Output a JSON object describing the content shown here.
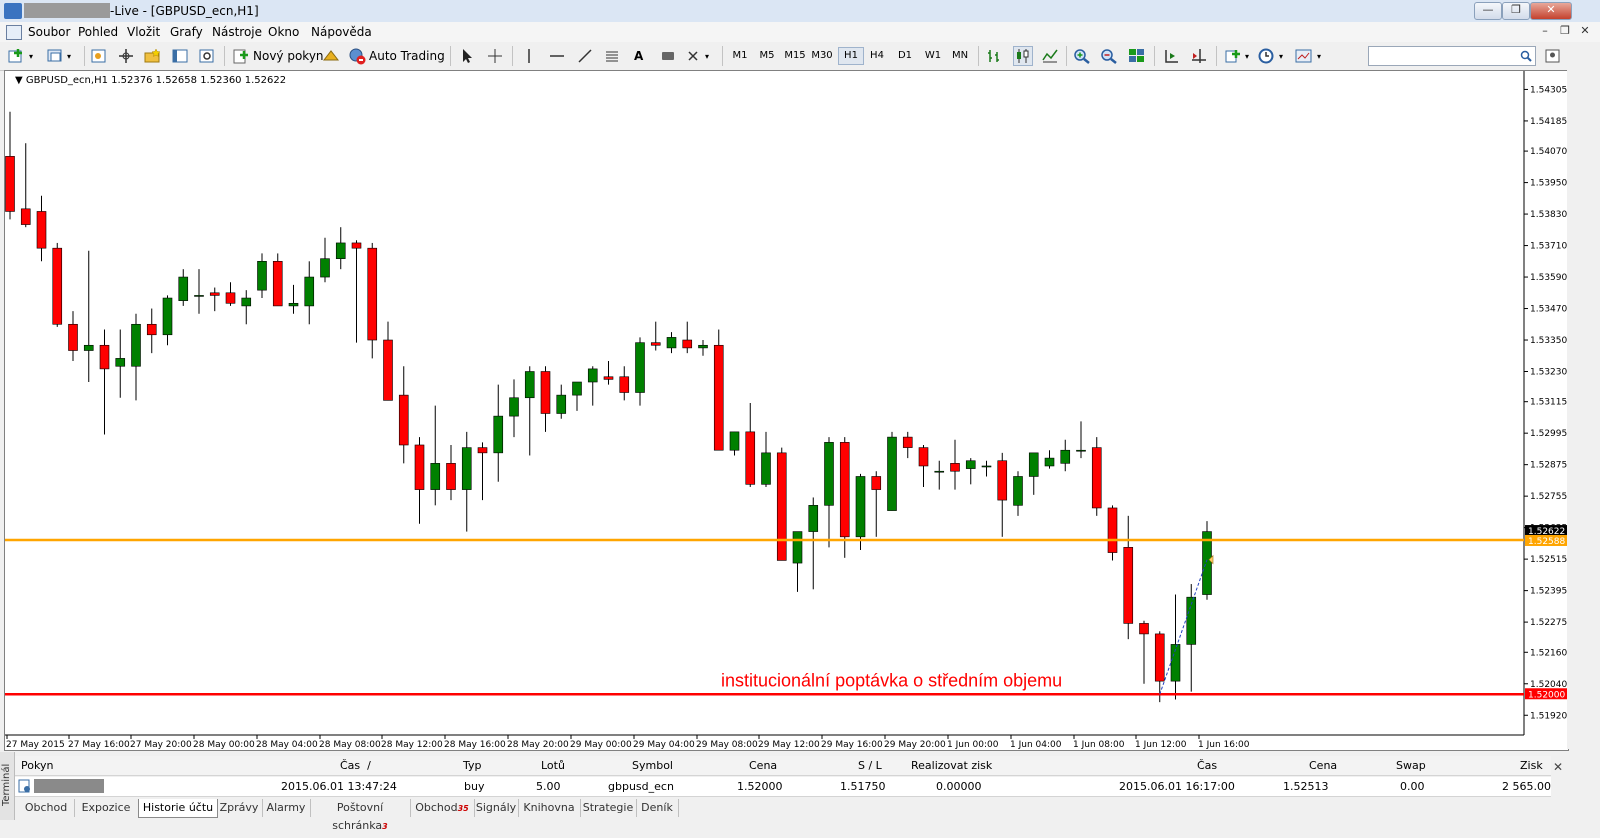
{
  "window": {
    "title": "-Live - [GBPUSD_ecn,H1]",
    "controls": [
      "—",
      "❐",
      "✕"
    ]
  },
  "menu": {
    "items": [
      "Soubor",
      "Pohled",
      "Vložit",
      "Grafy",
      "Nástroje",
      "Okno",
      "Nápověda"
    ]
  },
  "toolbar": {
    "new_order_label": "Nový pokyn",
    "auto_trading_label": "Auto Trading",
    "text_tool_label": "A",
    "timeframes": [
      "M1",
      "M5",
      "M15",
      "M30",
      "H1",
      "H4",
      "D1",
      "W1",
      "MN"
    ],
    "active_timeframe": "H1"
  },
  "chart": {
    "header": "GBPUSD_ecn,H1  1.52376 1.52658 1.52360 1.52622",
    "annotation": "institucionální poptávka o středním objemu",
    "price_labels": [
      "1.54305",
      "1.54185",
      "1.54070",
      "1.53950",
      "1.53830",
      "1.53710",
      "1.53590",
      "1.53470",
      "1.53350",
      "1.53230",
      "1.53115",
      "1.52995",
      "1.52875",
      "1.52755",
      "1.52635",
      "1.52515",
      "1.52395",
      "1.52275",
      "1.52160",
      "1.52040",
      "1.51920"
    ],
    "current_price": "1.52622",
    "orange_level": "1.52588",
    "red_level": "1.52000",
    "time_labels": [
      "27 May 2015",
      "27 May 16:00",
      "27 May 20:00",
      "28 May 00:00",
      "28 May 04:00",
      "28 May 08:00",
      "28 May 12:00",
      "28 May 16:00",
      "28 May 20:00",
      "29 May 00:00",
      "29 May 04:00",
      "29 May 08:00",
      "29 May 12:00",
      "29 May 16:00",
      "29 May 20:00",
      "1 Jun 00:00",
      "1 Jun 04:00",
      "1 Jun 08:00",
      "1 Jun 12:00",
      "1 Jun 16:00"
    ],
    "colors": {
      "bull": "#008000",
      "bear": "#ff0000",
      "orange_line": "#ffa500",
      "red_line": "#ff0000",
      "annotation": "#ff0000"
    }
  },
  "chart_data": {
    "type": "candlestick",
    "title": "GBPUSD_ecn,H1",
    "ylim": [
      1.5186,
      1.5436
    ],
    "candles": [
      {
        "o": 1.5405,
        "h": 1.5422,
        "l": 1.5381,
        "c": 1.5384
      },
      {
        "o": 1.5385,
        "h": 1.541,
        "l": 1.5378,
        "c": 1.5379
      },
      {
        "o": 1.5384,
        "h": 1.539,
        "l": 1.5365,
        "c": 1.537
      },
      {
        "o": 1.537,
        "h": 1.5372,
        "l": 1.534,
        "c": 1.5341
      },
      {
        "o": 1.5341,
        "h": 1.5346,
        "l": 1.5327,
        "c": 1.5331
      },
      {
        "o": 1.5331,
        "h": 1.5369,
        "l": 1.5319,
        "c": 1.5333
      },
      {
        "o": 1.5333,
        "h": 1.5339,
        "l": 1.5299,
        "c": 1.5324
      },
      {
        "o": 1.5325,
        "h": 1.5339,
        "l": 1.5313,
        "c": 1.5328
      },
      {
        "o": 1.5325,
        "h": 1.5345,
        "l": 1.5312,
        "c": 1.5341
      },
      {
        "o": 1.5341,
        "h": 1.5347,
        "l": 1.533,
        "c": 1.5337
      },
      {
        "o": 1.5337,
        "h": 1.5352,
        "l": 1.5333,
        "c": 1.5351
      },
      {
        "o": 1.535,
        "h": 1.5362,
        "l": 1.5348,
        "c": 1.5359
      },
      {
        "o": 1.5352,
        "h": 1.5362,
        "l": 1.5345,
        "c": 1.5352
      },
      {
        "o": 1.5353,
        "h": 1.5355,
        "l": 1.5346,
        "c": 1.5352
      },
      {
        "o": 1.5353,
        "h": 1.5357,
        "l": 1.5348,
        "c": 1.5349
      },
      {
        "o": 1.5348,
        "h": 1.5354,
        "l": 1.5341,
        "c": 1.5351
      },
      {
        "o": 1.5354,
        "h": 1.5368,
        "l": 1.5351,
        "c": 1.5365
      },
      {
        "o": 1.5365,
        "h": 1.5368,
        "l": 1.5348,
        "c": 1.5348
      },
      {
        "o": 1.5348,
        "h": 1.5356,
        "l": 1.5345,
        "c": 1.5349
      },
      {
        "o": 1.5348,
        "h": 1.5365,
        "l": 1.5341,
        "c": 1.5359
      },
      {
        "o": 1.5359,
        "h": 1.5374,
        "l": 1.5357,
        "c": 1.5366
      },
      {
        "o": 1.5366,
        "h": 1.5378,
        "l": 1.5362,
        "c": 1.5372
      },
      {
        "o": 1.5372,
        "h": 1.5373,
        "l": 1.5334,
        "c": 1.537
      },
      {
        "o": 1.537,
        "h": 1.5372,
        "l": 1.5328,
        "c": 1.5335
      },
      {
        "o": 1.5335,
        "h": 1.5342,
        "l": 1.5312,
        "c": 1.5312
      },
      {
        "o": 1.5314,
        "h": 1.5325,
        "l": 1.5288,
        "c": 1.5295
      },
      {
        "o": 1.5295,
        "h": 1.5298,
        "l": 1.5265,
        "c": 1.5278
      },
      {
        "o": 1.5278,
        "h": 1.531,
        "l": 1.5272,
        "c": 1.5288
      },
      {
        "o": 1.5288,
        "h": 1.5295,
        "l": 1.5274,
        "c": 1.5278
      },
      {
        "o": 1.5278,
        "h": 1.53,
        "l": 1.5262,
        "c": 1.5294
      },
      {
        "o": 1.5294,
        "h": 1.5296,
        "l": 1.5274,
        "c": 1.5292
      },
      {
        "o": 1.5292,
        "h": 1.5318,
        "l": 1.5281,
        "c": 1.5306
      },
      {
        "o": 1.5306,
        "h": 1.532,
        "l": 1.5298,
        "c": 1.5313
      },
      {
        "o": 1.5313,
        "h": 1.5325,
        "l": 1.5291,
        "c": 1.5323
      },
      {
        "o": 1.5323,
        "h": 1.5325,
        "l": 1.53,
        "c": 1.5307
      },
      {
        "o": 1.5307,
        "h": 1.5318,
        "l": 1.5305,
        "c": 1.5314
      },
      {
        "o": 1.5314,
        "h": 1.5318,
        "l": 1.5308,
        "c": 1.5319
      },
      {
        "o": 1.5319,
        "h": 1.5325,
        "l": 1.531,
        "c": 1.5324
      },
      {
        "o": 1.5321,
        "h": 1.5327,
        "l": 1.5318,
        "c": 1.532
      },
      {
        "o": 1.5321,
        "h": 1.5325,
        "l": 1.5312,
        "c": 1.5315
      },
      {
        "o": 1.5315,
        "h": 1.5336,
        "l": 1.531,
        "c": 1.5334
      },
      {
        "o": 1.5334,
        "h": 1.5342,
        "l": 1.5331,
        "c": 1.5333
      },
      {
        "o": 1.5332,
        "h": 1.5338,
        "l": 1.533,
        "c": 1.5336
      },
      {
        "o": 1.5335,
        "h": 1.5342,
        "l": 1.533,
        "c": 1.5332
      },
      {
        "o": 1.5332,
        "h": 1.5335,
        "l": 1.5329,
        "c": 1.5333
      },
      {
        "o": 1.5333,
        "h": 1.5339,
        "l": 1.5293,
        "c": 1.5293
      },
      {
        "o": 1.5293,
        "h": 1.53,
        "l": 1.5291,
        "c": 1.53
      },
      {
        "o": 1.53,
        "h": 1.5311,
        "l": 1.5279,
        "c": 1.528
      },
      {
        "o": 1.528,
        "h": 1.53,
        "l": 1.5279,
        "c": 1.5292
      },
      {
        "o": 1.5292,
        "h": 1.5294,
        "l": 1.5251,
        "c": 1.5251
      },
      {
        "o": 1.525,
        "h": 1.5261,
        "l": 1.5239,
        "c": 1.5262
      },
      {
        "o": 1.5262,
        "h": 1.5275,
        "l": 1.524,
        "c": 1.5272
      },
      {
        "o": 1.5272,
        "h": 1.5298,
        "l": 1.5256,
        "c": 1.5296
      },
      {
        "o": 1.5296,
        "h": 1.5298,
        "l": 1.5252,
        "c": 1.526
      },
      {
        "o": 1.526,
        "h": 1.5284,
        "l": 1.5255,
        "c": 1.5283
      },
      {
        "o": 1.5283,
        "h": 1.5285,
        "l": 1.526,
        "c": 1.5278
      },
      {
        "o": 1.527,
        "h": 1.53,
        "l": 1.527,
        "c": 1.5298
      },
      {
        "o": 1.5298,
        "h": 1.53,
        "l": 1.529,
        "c": 1.5294
      },
      {
        "o": 1.5294,
        "h": 1.5295,
        "l": 1.5279,
        "c": 1.5287
      },
      {
        "o": 1.5285,
        "h": 1.5289,
        "l": 1.5278,
        "c": 1.5285
      },
      {
        "o": 1.5288,
        "h": 1.5297,
        "l": 1.5278,
        "c": 1.5285
      },
      {
        "o": 1.5286,
        "h": 1.529,
        "l": 1.528,
        "c": 1.5289
      },
      {
        "o": 1.5287,
        "h": 1.5289,
        "l": 1.5283,
        "c": 1.5287
      },
      {
        "o": 1.5289,
        "h": 1.5292,
        "l": 1.526,
        "c": 1.5274
      },
      {
        "o": 1.5272,
        "h": 1.5285,
        "l": 1.5268,
        "c": 1.5283
      },
      {
        "o": 1.5283,
        "h": 1.529,
        "l": 1.5276,
        "c": 1.5292
      },
      {
        "o": 1.5287,
        "h": 1.5293,
        "l": 1.5286,
        "c": 1.529
      },
      {
        "o": 1.5288,
        "h": 1.5297,
        "l": 1.5285,
        "c": 1.5293
      },
      {
        "o": 1.5293,
        "h": 1.5304,
        "l": 1.529,
        "c": 1.5293
      },
      {
        "o": 1.5294,
        "h": 1.5298,
        "l": 1.5268,
        "c": 1.5271
      },
      {
        "o": 1.5271,
        "h": 1.5272,
        "l": 1.5251,
        "c": 1.5254
      },
      {
        "o": 1.5256,
        "h": 1.5268,
        "l": 1.5221,
        "c": 1.5227
      },
      {
        "o": 1.5227,
        "h": 1.5228,
        "l": 1.5204,
        "c": 1.5223
      },
      {
        "o": 1.5223,
        "h": 1.5224,
        "l": 1.5197,
        "c": 1.5205
      },
      {
        "o": 1.5205,
        "h": 1.5238,
        "l": 1.5198,
        "c": 1.5219
      },
      {
        "o": 1.5219,
        "h": 1.5242,
        "l": 1.5201,
        "c": 1.5237
      },
      {
        "o": 1.5238,
        "h": 1.5266,
        "l": 1.5236,
        "c": 1.5262
      }
    ]
  },
  "terminal": {
    "side_label": "Terminál",
    "headers": {
      "order": "Pokyn",
      "time": "Čas",
      "type": "Typ",
      "lots": "Lotů",
      "symbol": "Symbol",
      "price": "Cena",
      "sl_tp": "S / L",
      "realize": "Realizovat zisk",
      "close_time": "Čas",
      "close_price": "Cena",
      "swap": "Swap",
      "profit": "Zisk"
    },
    "row": {
      "time": "2015.06.01 13:47:24",
      "type": "buy",
      "lots": "5.00",
      "symbol": "gbpusd_ecn",
      "price": "1.52000",
      "sl_tp": "1.51750",
      "realize": "0.00000",
      "close_time": "2015.06.01 16:17:00",
      "close_price": "1.52513",
      "swap": "0.00",
      "profit": "2 565.00"
    },
    "tabs": [
      {
        "label": "Obchod"
      },
      {
        "label": "Expozice"
      },
      {
        "label": "Historie účtu",
        "active": true
      },
      {
        "label": "Zprávy"
      },
      {
        "label": "Alarmy"
      },
      {
        "label": "Poštovní schránka",
        "badge": "3"
      },
      {
        "label": "Obchod",
        "badge": "35"
      },
      {
        "label": "Signály"
      },
      {
        "label": "Knihovna"
      },
      {
        "label": "Strategie"
      },
      {
        "label": "Deník"
      }
    ]
  }
}
